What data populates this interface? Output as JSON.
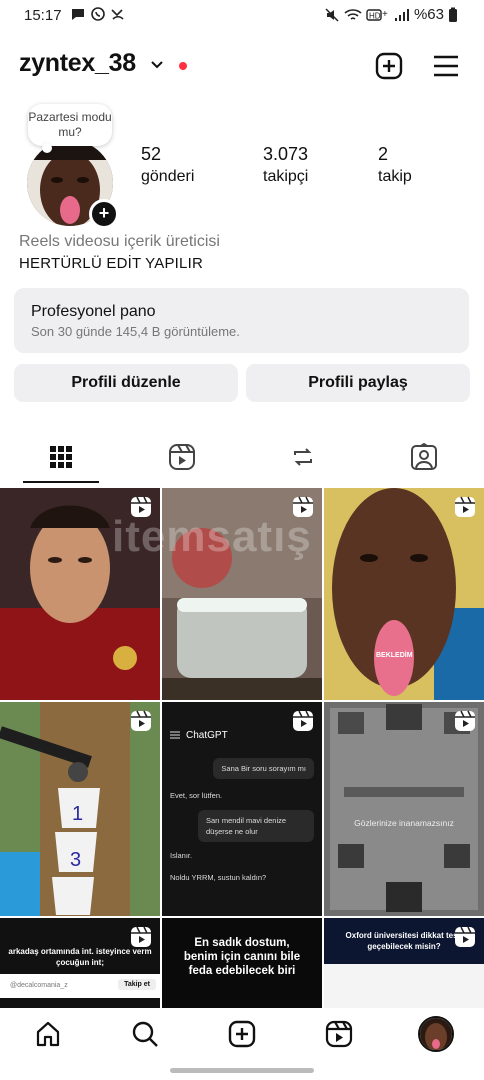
{
  "status_bar": {
    "time": "15:17",
    "battery": "%63"
  },
  "header": {
    "username": "zyntex_38"
  },
  "profile": {
    "note": "Pazartesi modu mu?",
    "stats": [
      {
        "value": "52",
        "label": "gönderi"
      },
      {
        "value": "3.073",
        "label": "takipçi"
      },
      {
        "value": "2",
        "label": "takip"
      }
    ],
    "category": "Reels videosu içerik üreticisi",
    "bio": "HERTÜRLÜ EDİT YAPILIR"
  },
  "pro_dashboard": {
    "title": "Profesyonel pano",
    "subtitle": "Son 30 günde 145,4 B görüntüleme."
  },
  "buttons": {
    "edit_profile": "Profili düzenle",
    "share_profile": "Profili paylaş"
  },
  "grid": {
    "watermark": "itemsatış",
    "cell3_caption": "BEKLEDİM",
    "chat": {
      "app_title": "ChatGPT",
      "messages": [
        "Sana Bir soru sorayım mı",
        "Evet, sor lütfen.",
        "Sarı mendil mavi denize düşerse ne olur",
        "Islanır.",
        "Noldu YRRM, sustun kaldın?"
      ]
    },
    "game_caption": "Gözlerinize inanamazsınız",
    "post7_text": "arkadaş ortamında int. isteyince verm çocuğun int;",
    "post7_user": "@decalcomania_z",
    "post7_follow": "Takip et",
    "post8_text": "En sadık dostum, benim için canını bile feda edebilecek biri",
    "post9_text": "Oxford üniversitesi dikkat testi geçebilecek misin?"
  },
  "colors": {
    "accent_red": "#ff3040",
    "button_bg": "#efeff1"
  }
}
